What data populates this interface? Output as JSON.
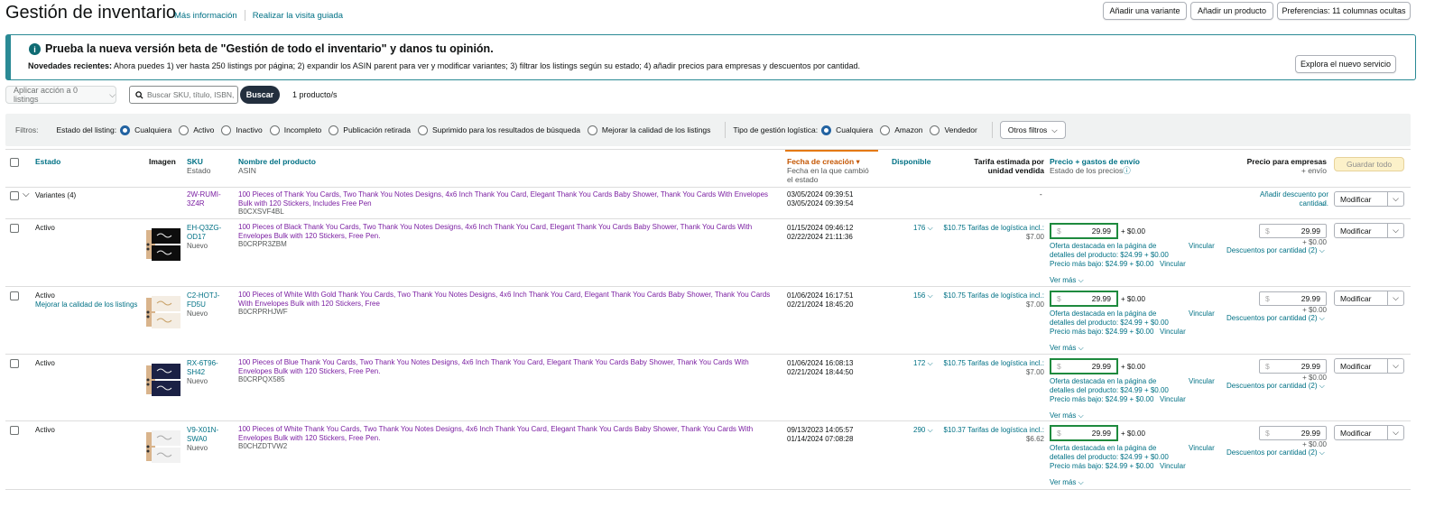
{
  "header": {
    "title": "Gestión de inventario",
    "more_info": "Más información",
    "guided_tour": "Realizar la visita guiada",
    "add_variant": "Añadir una variante",
    "add_product": "Añadir un producto",
    "preferences": "Preferencias: 11 columnas ocultas"
  },
  "banner": {
    "title": "Prueba la nueva versión beta de \"Gestión de todo el inventario\" y danos tu opinión.",
    "lead": "Novedades recientes:",
    "body": " Ahora puedes 1) ver hasta 250 listings por página; 2) expandir los ASIN parent para ver y modificar variantes; 3) filtrar los listings según su estado; 4) añadir precios para empresas y descuentos por cantidad.",
    "button": "Explora el nuevo servicio"
  },
  "actions": {
    "apply": "Aplicar acción a 0 listings",
    "search_placeholder": "Buscar SKU, título, ISBN,",
    "search_button": "Buscar",
    "count": "1 producto/s"
  },
  "filters": {
    "label": "Filtros:",
    "status_label": "Estado del listing:",
    "status_options": [
      "Cualquiera",
      "Activo",
      "Inactivo",
      "Incompleto",
      "Publicación retirada",
      "Suprimido para los resultados de búsqueda",
      "Mejorar la calidad de los listings"
    ],
    "logistics_label": "Tipo de gestión logística:",
    "logistics_options": [
      "Cualquiera",
      "Amazon",
      "Vendedor"
    ],
    "more_filters": "Otros filtros"
  },
  "columns": {
    "estado": "Estado",
    "imagen": "Imagen",
    "sku": "SKU",
    "sku_sub": "Estado",
    "nombre": "Nombre del producto",
    "nombre_sub": "ASIN",
    "fecha": "Fecha de creación",
    "fecha_sub": "Fecha en la que cambió el estado",
    "disponible": "Disponible",
    "tarifa": "Tarifa estimada por unidad vendida",
    "precio": "Precio + gastos de envío",
    "precio_sub": "Estado de los precios",
    "empresas": "Precio para empresas",
    "empresas_sub": "+ envío",
    "save_all": "Guardar todo"
  },
  "variant_row": {
    "label": "Variantes (4)",
    "sku": "2W-RUMI-3Z4R",
    "name": "100 Pieces of Thank You Cards, Two Thank You Notes Designs, 4x6 Inch Thank You Card, Elegant Thank You Cards Baby Shower, Thank You Cards With Envelopes Bulk with 120 Stickers, Includes Free Pen",
    "asin": "B0CXSVF4BL",
    "created": "03/05/2024 09:39:51",
    "changed": "03/05/2024 09:39:54",
    "price": "-",
    "discount": "Añadir descuento por cantidad.",
    "modify": "Modificar"
  },
  "rows": [
    {
      "status": "Activo",
      "status_link": "",
      "sku": "EH-Q3ZG-OD17",
      "condition": "Nuevo",
      "name": "100 Pieces of Black Thank You Cards, Two Thank You Notes Designs, 4x6 Inch Thank You Card, Elegant Thank You Cards Baby Shower, Thank You Cards With Envelopes Bulk with 120 Stickers, Free Pen.",
      "asin": "B0CRPR3ZBM",
      "created": "01/15/2024 09:46:12",
      "changed": "02/22/2024 21:11:36",
      "available": "176",
      "fee": "$10.75 Tarifas de logística incl.:",
      "fee2": "$7.00",
      "price": "29.99",
      "shipping": "+ $0.00",
      "featured": "Oferta destacada en la página de detalles del producto: $24.99 + $0.00",
      "lowest": "Precio más bajo: $24.99 + $0.00",
      "match": "Vincular",
      "see_more": "Ver más",
      "biz_price": "29.99",
      "biz_ship": "+ $0.00",
      "discounts": "Descuentos por cantidad (2)",
      "modify": "Modificar",
      "thumb": "black"
    },
    {
      "status": "Activo",
      "status_link": "Mejorar la calidad de los listings",
      "sku": "C2-HOTJ-FD5U",
      "condition": "Nuevo",
      "name": "100 Pieces of White With Gold Thank You Cards, Two Thank You Notes Designs, 4x6 Inch Thank You Card, Elegant Thank You Cards Baby Shower, Thank You Cards With Envelopes Bulk with 120 Stickers, Free",
      "asin": "B0CRPRHJWF",
      "created": "01/06/2024 16:17:51",
      "changed": "02/21/2024 18:45:20",
      "available": "156",
      "fee": "$10.75 Tarifas de logística incl.:",
      "fee2": "$7.00",
      "price": "29.99",
      "shipping": "+ $0.00",
      "featured": "Oferta destacada en la página de detalles del producto: $24.99 + $0.00",
      "lowest": "Precio más bajo: $24.99 + $0.00",
      "match": "Vincular",
      "see_more": "Ver más",
      "biz_price": "29.99",
      "biz_ship": "+ $0.00",
      "discounts": "Descuentos por cantidad (2)",
      "modify": "Modificar",
      "thumb": "white"
    },
    {
      "status": "Activo",
      "status_link": "",
      "sku": "RX-6T96-SH42",
      "condition": "Nuevo",
      "name": "100 Pieces of Blue Thank You Cards, Two Thank You Notes Designs, 4x6 Inch Thank You Card, Elegant Thank You Cards Baby Shower, Thank You Cards With Envelopes Bulk with 120 Stickers, Free Pen.",
      "asin": "B0CRPQX585",
      "created": "01/06/2024 16:08:13",
      "changed": "02/21/2024 18:44:50",
      "available": "172",
      "fee": "$10.75 Tarifas de logística incl.:",
      "fee2": "$7.00",
      "price": "29.99",
      "shipping": "+ $0.00",
      "featured": "Oferta destacada en la página de detalles del producto: $24.99 + $0.00",
      "lowest": "Precio más bajo: $24.99 + $0.00",
      "match": "Vincular",
      "see_more": "Ver más",
      "biz_price": "29.99",
      "biz_ship": "+ $0.00",
      "discounts": "Descuentos por cantidad (2)",
      "modify": "Modificar",
      "thumb": "navy"
    },
    {
      "status": "Activo",
      "status_link": "",
      "sku": "V9-X01N-SWA0",
      "condition": "Nuevo",
      "name": "100 Pieces of White Thank You Cards, Two Thank You Notes Designs, 4x6 Inch Thank You Card, Elegant Thank You Cards Baby Shower, Thank You Cards With Envelopes Bulk with 120 Stickers, Free Pen.",
      "asin": "B0CHZDTVW2",
      "created": "09/13/2023 14:05:57",
      "changed": "01/14/2024 07:08:28",
      "available": "290",
      "fee": "$10.37 Tarifas de logística incl.:",
      "fee2": "$6.62",
      "price": "29.99",
      "shipping": "+ $0.00",
      "featured": "Oferta destacada en la página de detalles del producto: $24.99 + $0.00",
      "lowest": "Precio más bajo: $24.99 + $0.00",
      "match": "Vincular",
      "see_more": "Ver más",
      "biz_price": "29.99",
      "biz_ship": "+ $0.00",
      "discounts": "Descuentos por cantidad (2)",
      "modify": "Modificar",
      "thumb": "plain"
    }
  ],
  "colors": {
    "link": "#007185",
    "product_name": "#7b1fa2",
    "price_border": "#1e8a3e",
    "banner_border": "#2a8a95"
  }
}
